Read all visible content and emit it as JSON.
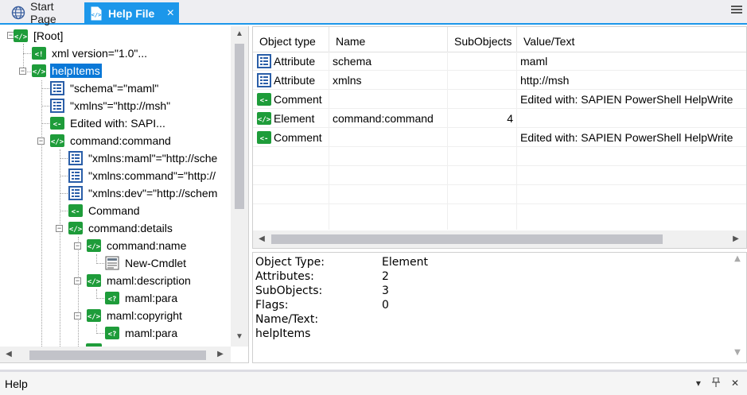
{
  "tabs": [
    {
      "label": "Start Page",
      "icon": "globe-icon"
    },
    {
      "label": "Help File",
      "icon": "xml-file-icon",
      "close": "×"
    }
  ],
  "tree": [
    {
      "label": "[Root]",
      "icon": "element"
    },
    {
      "label": "xml version=\"1.0\"...",
      "icon": "declaration"
    },
    {
      "label": "helpItems",
      "icon": "element"
    },
    {
      "label": "\"schema\"=\"maml\"",
      "icon": "attribute"
    },
    {
      "label": "\"xmlns\"=\"http://msh\"",
      "icon": "attribute"
    },
    {
      "label": "Edited with: SAPI...",
      "icon": "comment"
    },
    {
      "label": "command:command",
      "icon": "element"
    },
    {
      "label": "\"xmlns:maml\"=\"http://sche",
      "icon": "attribute"
    },
    {
      "label": "\"xmlns:command\"=\"http://",
      "icon": "attribute"
    },
    {
      "label": "\"xmlns:dev\"=\"http://schem",
      "icon": "attribute"
    },
    {
      "label": "Command",
      "icon": "comment"
    },
    {
      "label": "command:details",
      "icon": "element"
    },
    {
      "label": "command:name",
      "icon": "element"
    },
    {
      "label": "New-Cmdlet",
      "icon": "text"
    },
    {
      "label": "maml:description",
      "icon": "element"
    },
    {
      "label": "maml:para",
      "icon": "pi"
    },
    {
      "label": "maml:copyright",
      "icon": "element"
    },
    {
      "label": "maml:para",
      "icon": "pi"
    }
  ],
  "grid": {
    "headers": [
      "Object type",
      "Name",
      "SubObjects",
      "Value/Text"
    ],
    "rows": [
      {
        "type": "Attribute",
        "icon": "attribute",
        "name": "schema",
        "sub": "",
        "value": "maml"
      },
      {
        "type": "Attribute",
        "icon": "attribute",
        "name": "xmlns",
        "sub": "",
        "value": "http://msh"
      },
      {
        "type": "Comment",
        "icon": "comment",
        "name": "",
        "sub": "",
        "value": "Edited with: SAPIEN PowerShell HelpWrite"
      },
      {
        "type": "Element",
        "icon": "element",
        "name": "command:command",
        "sub": "4",
        "value": ""
      },
      {
        "type": "Comment",
        "icon": "comment",
        "name": "",
        "sub": "",
        "value": "Edited with: SAPIEN PowerShell HelpWrite"
      }
    ]
  },
  "details": {
    "rows": [
      {
        "label": "Object Type:",
        "value": "Element"
      },
      {
        "label": "Attributes:",
        "value": "2"
      },
      {
        "label": "SubObjects:",
        "value": "3"
      },
      {
        "label": "Flags:",
        "value": "0"
      },
      {
        "label": "Name/Text:",
        "value": ""
      },
      {
        "label": "helpItems",
        "value": ""
      }
    ]
  },
  "helpbar": {
    "title": "Help",
    "buttons": [
      "▾",
      "📌",
      "✕"
    ]
  },
  "colors": {
    "accent": "#1c97ea",
    "selection": "#0a78d7",
    "icon_green": "#1e9c3a",
    "icon_blue": "#2a5ea8"
  }
}
